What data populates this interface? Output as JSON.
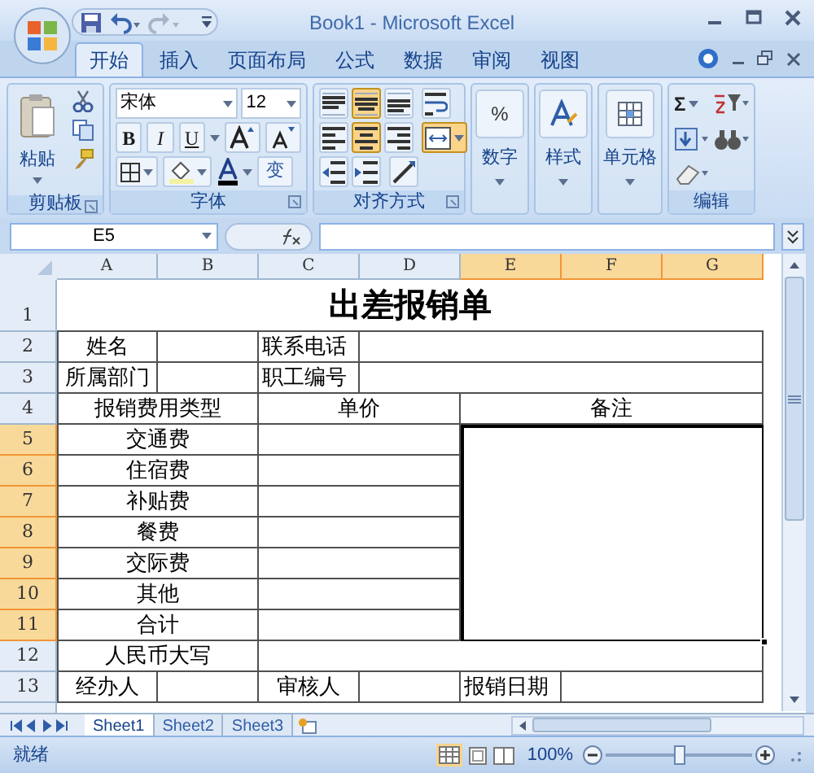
{
  "window": {
    "title": "Book1 - Microsoft Excel"
  },
  "ribbon": {
    "tabs": [
      {
        "label": "开始",
        "selected": true
      },
      {
        "label": "插入",
        "selected": false
      },
      {
        "label": "页面布局",
        "selected": false
      },
      {
        "label": "公式",
        "selected": false
      },
      {
        "label": "数据",
        "selected": false
      },
      {
        "label": "审阅",
        "selected": false
      },
      {
        "label": "视图",
        "selected": false
      }
    ],
    "clipboard": {
      "label": "剪贴板",
      "paste": "粘贴"
    },
    "font": {
      "label": "字体",
      "font_name": "宋体",
      "font_size": "12",
      "bold": "B",
      "italic": "I",
      "underline": "U",
      "wen": "变"
    },
    "alignment": {
      "label": "对齐方式",
      "buttons": [
        {
          "kind": "top",
          "selected": false
        },
        {
          "kind": "middle",
          "selected": true
        },
        {
          "kind": "bottom",
          "selected": false
        },
        {
          "kind": "wrap",
          "selected": false
        },
        {
          "kind": "left",
          "selected": false
        },
        {
          "kind": "center",
          "selected": true
        },
        {
          "kind": "right",
          "selected": false
        },
        {
          "kind": "merge",
          "selected": true
        },
        {
          "kind": "outdent",
          "selected": false
        },
        {
          "kind": "indent",
          "selected": false
        },
        {
          "kind": "orient",
          "selected": false
        }
      ]
    },
    "number": {
      "label": "数字",
      "symbol": "%"
    },
    "styles": {
      "label": "样式"
    },
    "cells": {
      "label": "单元格"
    },
    "editing": {
      "label": "编辑",
      "sum": "Σ"
    }
  },
  "formula_bar": {
    "name_box": "E5"
  },
  "sheet": {
    "columns": [
      {
        "label": "A",
        "selected": false
      },
      {
        "label": "B",
        "selected": false
      },
      {
        "label": "C",
        "selected": false
      },
      {
        "label": "D",
        "selected": false
      },
      {
        "label": "E",
        "selected": true
      },
      {
        "label": "F",
        "selected": true
      },
      {
        "label": "G",
        "selected": true
      }
    ],
    "rows": [
      {
        "header": "1",
        "selected": false,
        "cells": [
          "",
          "",
          "",
          "出差报销单",
          "",
          "",
          ""
        ]
      },
      {
        "header": "2",
        "selected": false,
        "cells": [
          "姓名",
          "",
          "联系电话",
          "",
          "",
          "",
          ""
        ]
      },
      {
        "header": "3",
        "selected": false,
        "cells": [
          "所属部门",
          "",
          "职工编号",
          "",
          "",
          "",
          ""
        ]
      },
      {
        "header": "4",
        "selected": false,
        "cells": [
          "报销费用类型",
          "",
          "单价",
          "",
          "",
          "备注",
          ""
        ]
      },
      {
        "header": "5",
        "selected": true,
        "cells": [
          "交通费",
          "",
          "",
          "",
          "",
          "",
          ""
        ]
      },
      {
        "header": "6",
        "selected": true,
        "cells": [
          "住宿费",
          "",
          "",
          "",
          "",
          "",
          ""
        ]
      },
      {
        "header": "7",
        "selected": true,
        "cells": [
          "补贴费",
          "",
          "",
          "",
          "",
          "",
          ""
        ]
      },
      {
        "header": "8",
        "selected": true,
        "cells": [
          "餐费",
          "",
          "",
          "",
          "",
          "",
          ""
        ]
      },
      {
        "header": "9",
        "selected": true,
        "cells": [
          "交际费",
          "",
          "",
          "",
          "",
          "",
          ""
        ]
      },
      {
        "header": "10",
        "selected": true,
        "cells": [
          "其他",
          "",
          "",
          "",
          "",
          "",
          ""
        ]
      },
      {
        "header": "11",
        "selected": true,
        "cells": [
          "合计",
          "",
          "",
          "",
          "",
          "",
          ""
        ]
      },
      {
        "header": "12",
        "selected": false,
        "cells": [
          "人民币大写",
          "",
          "",
          "",
          "",
          "",
          ""
        ]
      },
      {
        "header": "13",
        "selected": false,
        "cells": [
          "经办人",
          "",
          "审核人",
          "",
          "报销日期",
          "",
          ""
        ]
      }
    ]
  },
  "sheet_tabs": [
    {
      "label": "Sheet1",
      "selected": true
    },
    {
      "label": "Sheet2",
      "selected": false
    },
    {
      "label": "Sheet3",
      "selected": false
    }
  ],
  "status_bar": {
    "status": "就绪",
    "zoom": "100%",
    "zoom_slider": {
      "level": 0.5
    }
  }
}
